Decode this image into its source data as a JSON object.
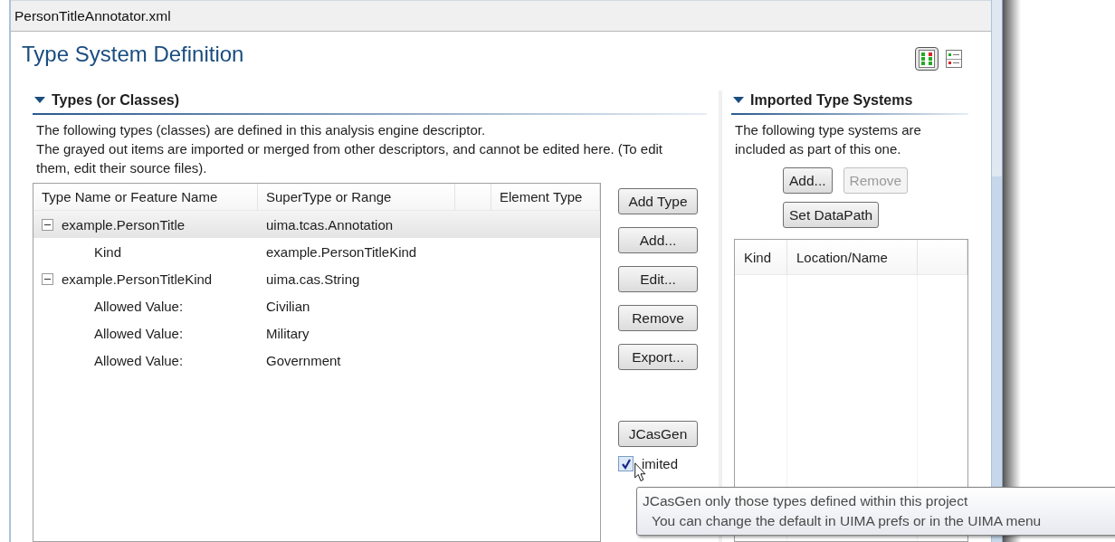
{
  "editor_tab": {
    "title": "PersonTitleAnnotator.xml"
  },
  "page_title": "Type System Definition",
  "layout_toggles": [
    {
      "selected": true
    },
    {
      "selected": false
    }
  ],
  "types_section": {
    "title": "Types (or Classes)",
    "expanded": true,
    "description": [
      "The following types (classes) are defined in this analysis engine descriptor.",
      "The grayed out items are imported or merged from other descriptors, and cannot be edited here. (To edit them, edit their source files)."
    ],
    "table": {
      "columns": [
        "Type Name or Feature Name",
        "SuperType or Range",
        "Element Type"
      ],
      "rows": [
        {
          "name": "example.PersonTitle",
          "range": "uima.tcas.Annotation",
          "expanded": true,
          "selected": true,
          "children": [
            {
              "name": "Kind",
              "range": "example.PersonTitleKind",
              "selected": false
            }
          ]
        },
        {
          "name": "example.PersonTitleKind",
          "range": "uima.cas.String",
          "expanded": true,
          "selected": false,
          "children": [
            {
              "name": "Allowed Value:",
              "range": "Civilian",
              "selected": false
            },
            {
              "name": "Allowed Value:",
              "range": "Military",
              "selected": false
            },
            {
              "name": "Allowed Value:",
              "range": "Government",
              "selected": false
            }
          ]
        }
      ]
    },
    "buttons": [
      {
        "label": "Add Type",
        "disabled": false
      },
      {
        "label": "Add...",
        "disabled": false
      },
      {
        "label": "Edit...",
        "disabled": false
      },
      {
        "label": "Remove",
        "disabled": false
      },
      {
        "label": "Export...",
        "disabled": false
      }
    ],
    "jcasgen_button": {
      "label": "JCasGen",
      "disabled": false
    },
    "limited_checkbox": {
      "label": "imited",
      "checked": true
    },
    "tooltip": [
      "JCasGen only those types defined within this project",
      "You can change the default in UIMA prefs or in the UIMA menu"
    ]
  },
  "imported_section": {
    "title": "Imported Type Systems",
    "expanded": true,
    "description": "The following type systems are included as part of this one.",
    "buttons": [
      {
        "label": "Add...",
        "disabled": false
      },
      {
        "label": "Remove",
        "disabled": true
      },
      {
        "label": "Set DataPath",
        "disabled": false
      }
    ],
    "table": {
      "columns": [
        "Kind",
        "Location/Name"
      ]
    }
  }
}
